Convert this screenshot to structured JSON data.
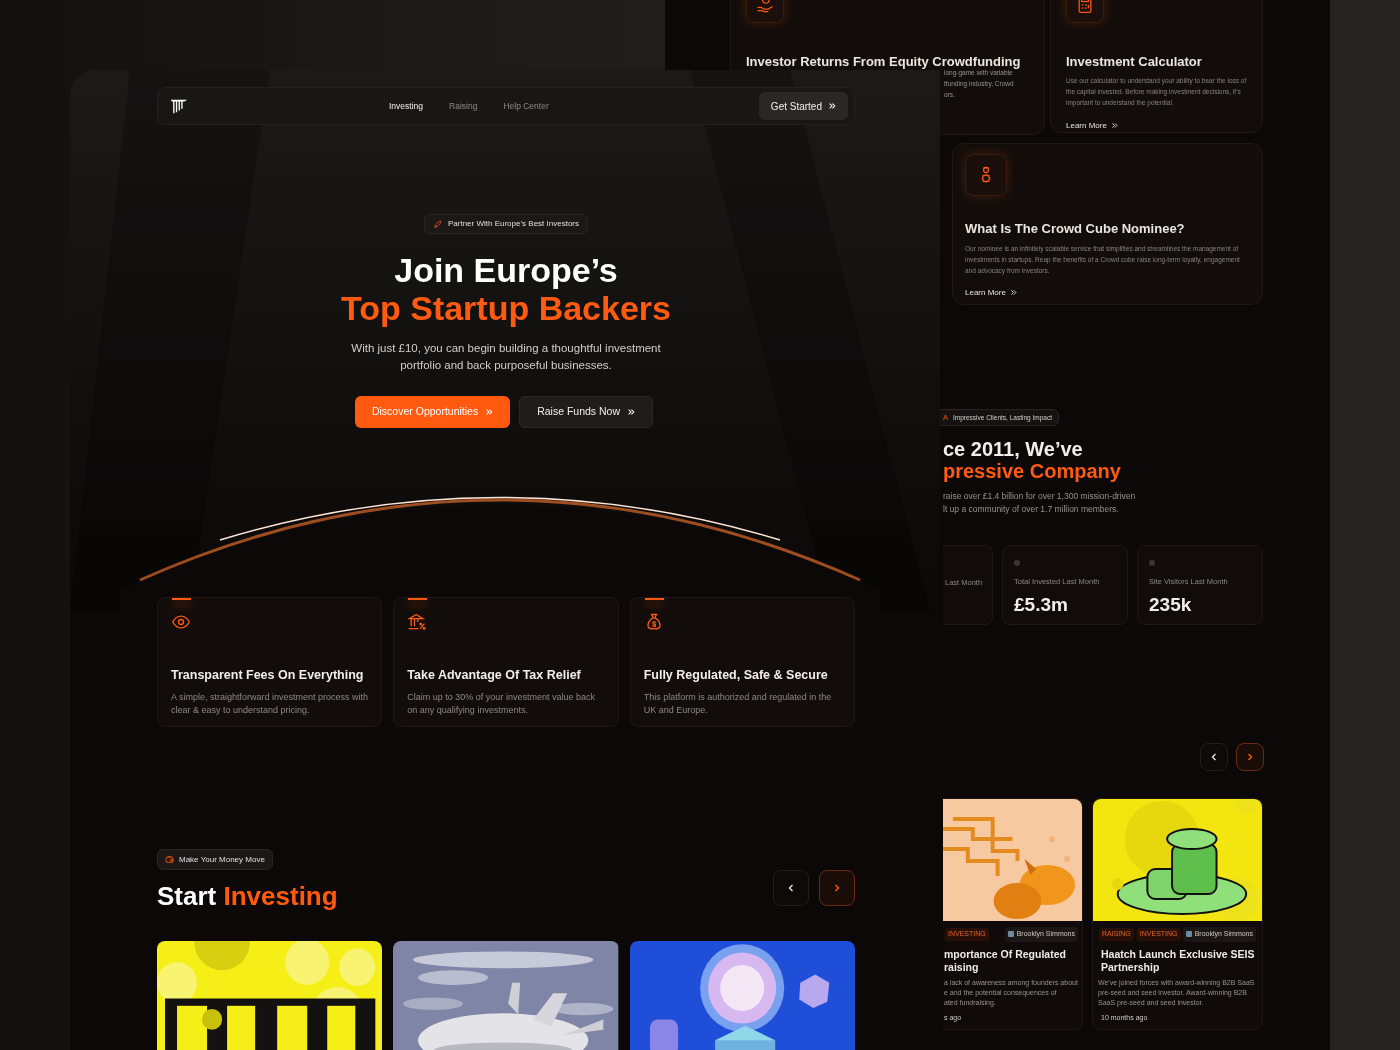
{
  "back_page": {
    "cards": [
      {
        "title": "Investor Returns From Equity Crowdfunding",
        "body_lines": [
          "long-game with variable",
          "tfunding industry, Crowd",
          "ors."
        ]
      },
      {
        "title": "Investment Calculator",
        "body": "Use our calculator to understand your ability to bear the loss of the capital invested. Before making investment decisions, it's important to understand the potential.",
        "link": "Learn More"
      },
      {
        "title": "What Is The Crowd Cube Nominee?",
        "body": "Our nominee is an infinitely scalable service that simplifies and streamlines the management of investments in startups. Reap the benefits of a Crowd cube raise long-term loyalty, engagement and advocacy from investors.",
        "link": "Learn More"
      }
    ],
    "impact": {
      "badge": "Impressive Clients, Lasting Impact",
      "heading_line_1": "ce 2011, We’ve",
      "heading_line_2": "pressive Company",
      "body_lines": [
        "raise over £1.4 billion for over 1,300 mission-driven",
        "lt up a community of over 1.7 million members."
      ]
    },
    "stats": [
      {
        "label": "Last Month"
      },
      {
        "label": "Total Invested Last Month",
        "value": "£5.3m"
      },
      {
        "label": "Site Visitors Last Month",
        "value": "235k"
      }
    ],
    "carousel": [
      {
        "kind": "prev",
        "active": false
      },
      {
        "kind": "next",
        "active": true
      }
    ],
    "articles": [
      {
        "tags": [
          "INVESTING"
        ],
        "author": "Brooklyn Simmons",
        "title_lines": [
          "mportance Of Regulated",
          "raising"
        ],
        "body_lines": [
          "a lack of awareness among founders about",
          "e and the potential consequences of",
          "ated fundraising."
        ],
        "time": "s ago"
      },
      {
        "tags": [
          "RAISING",
          "INVESTING"
        ],
        "author": "Brooklyn Simmons",
        "title_lines": [
          "Haatch Launch Exclusive SEIS",
          "Partnership"
        ],
        "body_lines": [
          "We've joined forces with award-winning B2B SaaS",
          "pre-seed and seed investor. Award-winning B2B",
          "SaaS pre-seed and seed investor."
        ],
        "time": "10 months ago"
      }
    ]
  },
  "front_page": {
    "nav": {
      "links": [
        {
          "label": "Investing",
          "selected": true
        },
        {
          "label": "Raising",
          "selected": false
        },
        {
          "label": "Help Center",
          "selected": false
        }
      ],
      "cta": "Get Started"
    },
    "hero": {
      "badge": "Partner With Europe’s Best Investors",
      "title_line_1": "Join Europe’s",
      "title_line_2": "Top Startup Backers",
      "text": "With just £10, you can begin building a thoughtful investment portfolio and back purposeful businesses.",
      "buttons": [
        {
          "label": "Discover Opportunities",
          "kind": "primary"
        },
        {
          "label": "Raise Funds Now",
          "kind": "secondary"
        }
      ]
    },
    "features": [
      {
        "title": "Transparent Fees On Everything",
        "text": "A simple, straightforward investment process with clear & easy to understand pricing."
      },
      {
        "title": "Take Advantage Of Tax Relief",
        "text": "Claim up to 30% of your investment value back on any qualifying investments."
      },
      {
        "title": "Fully Regulated, Safe & Secure",
        "text": "This platform is authorized and regulated in the UK and Europe."
      }
    ],
    "investing": {
      "badge": "Make Your Money Move",
      "title_start": "Start",
      "title_accent": "Investing",
      "carousel": [
        {
          "kind": "prev",
          "active": false
        },
        {
          "kind": "next",
          "active": true
        }
      ]
    }
  }
}
